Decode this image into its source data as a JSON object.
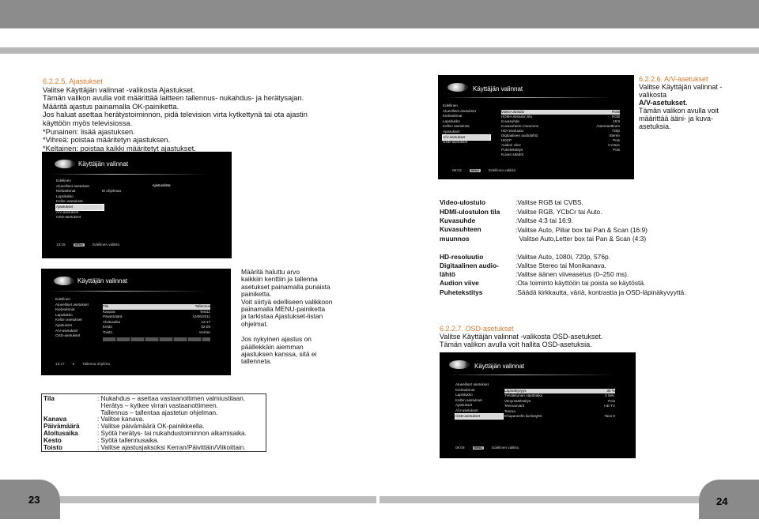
{
  "left": {
    "heading": "6.2.2.5. Ajastukset",
    "lines": [
      "Valitse Käyttäjän valinnat -valikosta Ajastukset.",
      "Tämän valikon avulla voit määrittää laitteen tallennus- nukahdus- ja herätysajan.",
      "Määritä ajastus painamalla OK-painiketta.",
      "Jos haluat asettaa herätystoiminnon, pidä television virta kytkettynä tai ota ajastin",
      "käyttöön myös televisiossa.",
      "*Punainen: lisää ajastuksen.",
      "*Vihreä: poistaa määritetyn ajastuksen.",
      "*Keltainen: poistaa kaikki määritetyt ajastukset."
    ]
  },
  "osd_common": {
    "title": "Käyttäjän valinnat",
    "back": "Edellinen",
    "menu_btn": "MENU",
    "menu_items": [
      "Alueelliset asetukset",
      "Kielivalinnat",
      "Lapsilukko",
      "Kellon asetukset",
      "Ajastukset",
      "A/V-asetukset",
      "OSD-asetukset"
    ]
  },
  "osd_timers": {
    "panel_title": "Ajastuslista",
    "panel_item": "Ei ohjelmaa",
    "time": "13:16",
    "footer": "Edellinen valikko"
  },
  "osd_add": {
    "time": "13:17",
    "footer": "Tallenna ohjelma",
    "rows": [
      [
        "Tila",
        "Tallennus"
      ],
      [
        "Kanava",
        "Test11"
      ],
      [
        "Päivämäärä",
        "10/06/2011"
      ],
      [
        "Aloitusaika",
        "13:17"
      ],
      [
        "Kesto",
        "02:00"
      ],
      [
        "Toisto",
        "Kerran"
      ]
    ]
  },
  "mid_text": {
    "p1": [
      "Määritä haluttu arvo",
      "kaikkiin kenttiin ja tallenna",
      "asetukset painamalla punaista",
      "painiketta.",
      "Voit siirtyä edelliseen valikkoon",
      "painamalla MENU-painiketta",
      "ja tarkistaa Ajastukset-listan",
      "ohjelmat."
    ],
    "p2": [
      "Jos nykyinen ajastus on",
      "päällekkäin aiemman",
      "ajastuksen kanssa, sitä ei",
      "tallenneta."
    ]
  },
  "osd_av": {
    "time": "06:03",
    "footer": "Edellinen valikko",
    "rows": [
      [
        "Video-ulostulo",
        "RGB"
      ],
      [
        "HDMI-ulostulon tila",
        "RGB"
      ],
      [
        "Kuvasuhde",
        "16:9"
      ],
      [
        "Kuvasuhteen muunnos",
        "Automaattinen"
      ],
      [
        "HD-resoluutio",
        "720p"
      ],
      [
        "Digitaalinen audiolähtö",
        "Stereo"
      ],
      [
        "HDCP",
        "Pois"
      ],
      [
        "Audion viive",
        "0 msec"
      ],
      [
        "Puhetekstitys",
        "Pois"
      ],
      [
        "Kuvan säädöt",
        ""
      ]
    ]
  },
  "av_text": {
    "heading": "6.2.2.6. A/V-asetukset",
    "lines": [
      "Valitse Käyttäjän valinnat -",
      "valikosta",
      "A/V-asetukset.",
      "Tämän valikon avulla voit",
      "määrittää ääni- ja kuva-",
      "asetuksia."
    ]
  },
  "av_table": [
    {
      "label": [
        "Video-ulostulo"
      ],
      "value": [
        ":Valitse RGB tai CVBS."
      ]
    },
    {
      "label": [
        "HDMI-ulostulon tila"
      ],
      "value": [
        ":Valitse RGB, YCbCr tai Auto."
      ]
    },
    {
      "label": [
        "Kuvasuhde"
      ],
      "value": [
        ":Valitse 4:3 tai 16:9."
      ]
    },
    {
      "label": [
        "Kuvasuhteen",
        "muunnos"
      ],
      "value": [
        ":Valitse Auto, Pillar box tai Pan & Scan (16:9)",
        "  Valitse Auto,Letter box tai Pan & Scan (4:3)"
      ]
    },
    {
      "label": [
        "HD-resoluutio"
      ],
      "value": [
        ":Valitse Auto, 1080i, 720p, 576p."
      ]
    },
    {
      "label": [
        "Digitaalinen audio-",
        "lähtö"
      ],
      "value": [
        ":Valitse Stereo tai Monikanava."
      ]
    },
    {
      "label": [
        "Audion viive"
      ],
      "value": [
        ":Valitse äänen viiveasetus (0–250 ms)."
      ]
    },
    {
      "label": [
        "Puhetekstitys"
      ],
      "value": [
        ":Ota toiminto käyttöön tai poista se käytöstä.",
        ":Säädä kirkkautta, väriä, kontrastia ja OSD-läpinäkyvyyttä."
      ]
    }
  ],
  "osd_text": {
    "heading": "6.2.2.7. OSD-asetukset",
    "lines": [
      "Valitse Käyttäjän valinnat -valikosta OSD-asetukset.",
      "Tämän valikon avulla voit hallita OSD-asetuksia."
    ]
  },
  "osd_osd": {
    "time": "06:09",
    "footer": "Edellinen valikko",
    "rows": [
      [
        "Läpinäkyvyys",
        "30 %"
      ],
      [
        "Tietoikkunan näyttöaika",
        "3 Sek."
      ],
      [
        "Venymätekstitys",
        "Pois"
      ],
      [
        "Teemanvärit",
        "HD TV"
      ],
      [
        "Teema",
        ""
      ],
      [
        "Ehupaneelin kielinäyttö",
        "Taso 8"
      ]
    ]
  },
  "timer_table": [
    {
      "label": "Tila",
      "value": [
        ": Nukahdus – asettaa vastaanottimen valmiustilaan.",
        "  Herätys – kytkee virran vastaanottimeen.",
        "  Tallennus – tallentaa ajastetun ohjelman."
      ]
    },
    {
      "label": "Kanava",
      "value": [
        ": Valitse kanava."
      ]
    },
    {
      "label": "Päivämäärä",
      "value": [
        ": Valitse päivämäärä OK-painikkeella."
      ]
    },
    {
      "label": "Aloitusaika",
      "value": [
        ": Syötä herätys- tai nukahdustoiminnon alkamisaika."
      ]
    },
    {
      "label": "Kesto",
      "value": [
        ": Syötä tallennusaika."
      ]
    },
    {
      "label": "Toisto",
      "value": [
        ": Valitse ajastusjaksoksi Kerran/Päivittäin/Viikoittain."
      ]
    }
  ],
  "pages": {
    "left": "23",
    "right": "24"
  }
}
